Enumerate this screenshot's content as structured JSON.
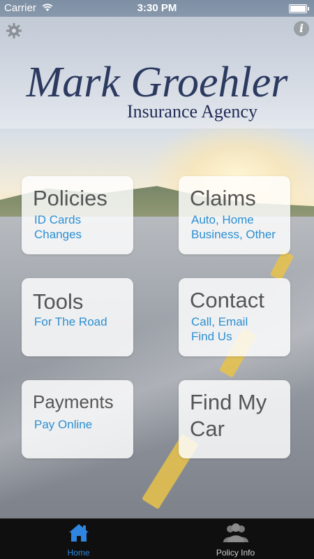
{
  "status_bar": {
    "carrier": "Carrier",
    "time": "3:30 PM"
  },
  "header": {
    "logo_main": "Mark Groehler",
    "logo_sub": "Insurance Agency",
    "settings_icon": "gear-icon",
    "info_icon": "info-icon",
    "info_glyph": "i"
  },
  "tiles": [
    {
      "title": "Policies",
      "lines": [
        "ID Cards",
        "Changes"
      ]
    },
    {
      "title": "Claims",
      "lines": [
        "Auto, Home",
        "Business, Other"
      ]
    },
    {
      "title": "Tools",
      "lines": [
        "For The Road"
      ]
    },
    {
      "title": "Contact",
      "lines": [
        "Call, Email",
        "Find Us"
      ]
    },
    {
      "title": "Payments",
      "lines": [
        "Pay Online"
      ]
    },
    {
      "title_lines": [
        "Find My",
        "Car"
      ]
    }
  ],
  "tabbar": {
    "items": [
      {
        "label": "Home",
        "icon": "house-icon",
        "active": true
      },
      {
        "label": "Policy Info",
        "icon": "people-icon",
        "active": false
      }
    ],
    "active_color": "#2f86e0"
  }
}
